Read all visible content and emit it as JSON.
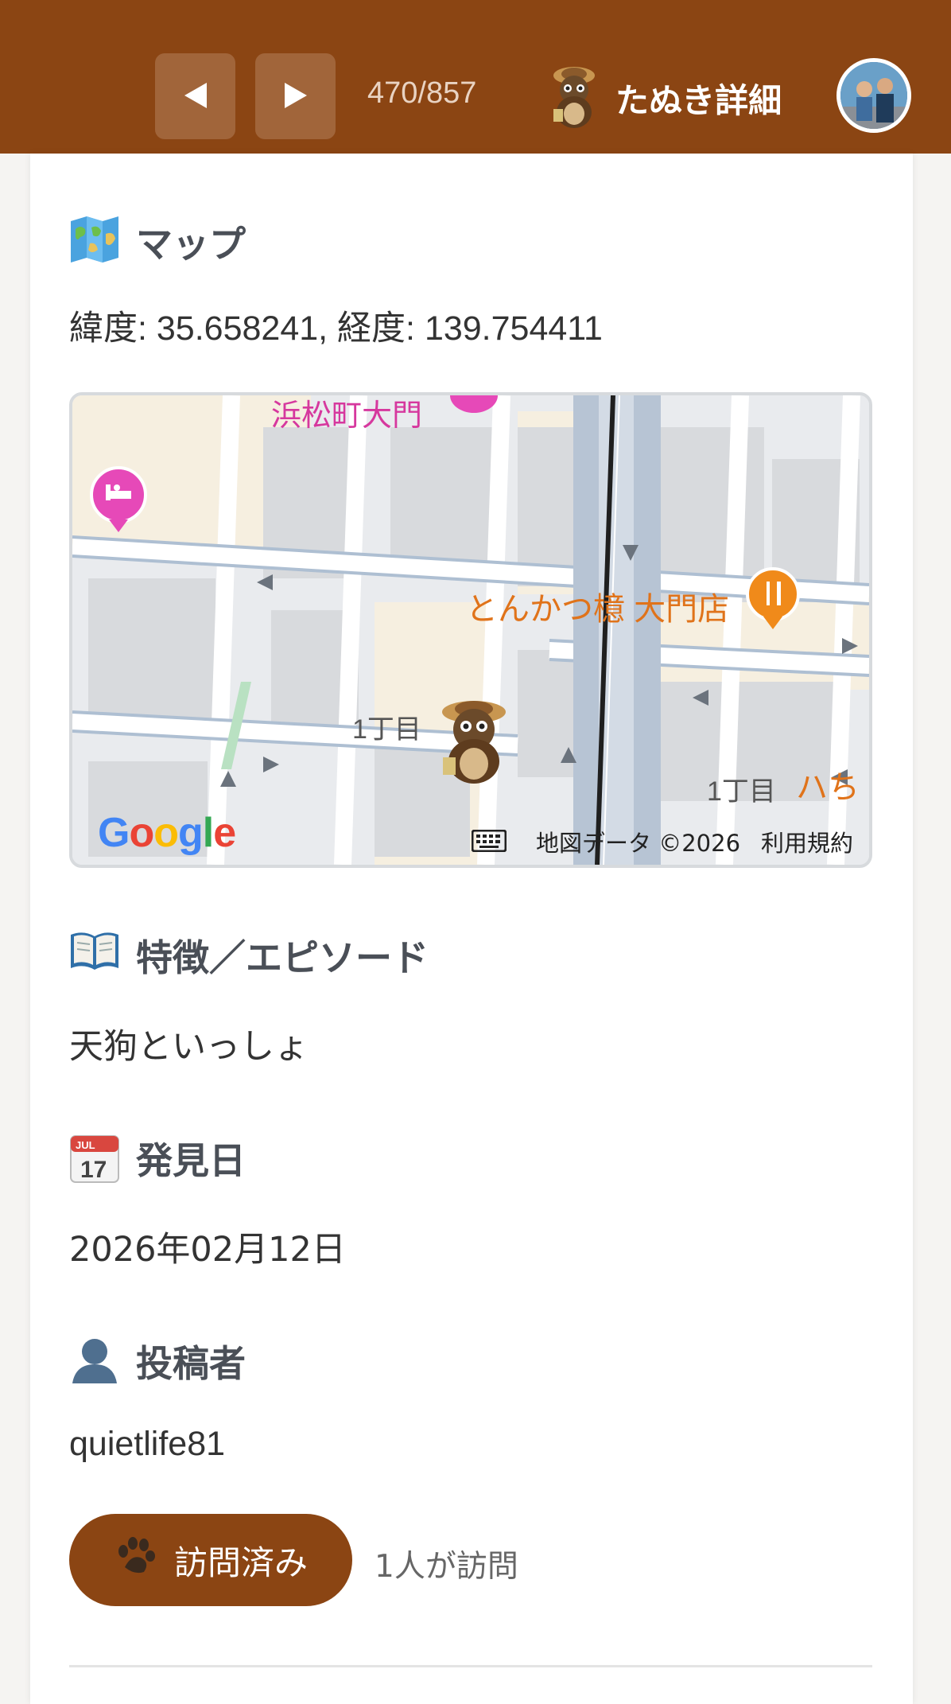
{
  "header": {
    "counter": "470/857",
    "title": "たぬき詳細",
    "map_button_icon": "map-icon",
    "prev_button_label": "◀",
    "next_button_label": "▶",
    "bg_color": "#8b4513"
  },
  "map_section": {
    "title": "マップ",
    "coords": "緯度: 35.658241, 経度: 139.754411",
    "map": {
      "labels": {
        "station": "浜松町大門",
        "restaurant": "とんかつ檍 大門店",
        "block1": "1丁目",
        "block2": "1丁目",
        "partial": "ハち"
      },
      "google": "Google",
      "attribution": "地図データ ©2026",
      "terms": "利用規約"
    }
  },
  "episode_section": {
    "title": "特徴／エピソード",
    "text": "天狗といっしょ"
  },
  "date_section": {
    "title": "発見日",
    "calendar_month": "JUL",
    "calendar_day": "17",
    "text": "2026年02月12日"
  },
  "poster_section": {
    "title": "投稿者",
    "text": "quietlife81"
  },
  "visit": {
    "button_label": "訪問済み",
    "count_text": "1人が訪問"
  }
}
